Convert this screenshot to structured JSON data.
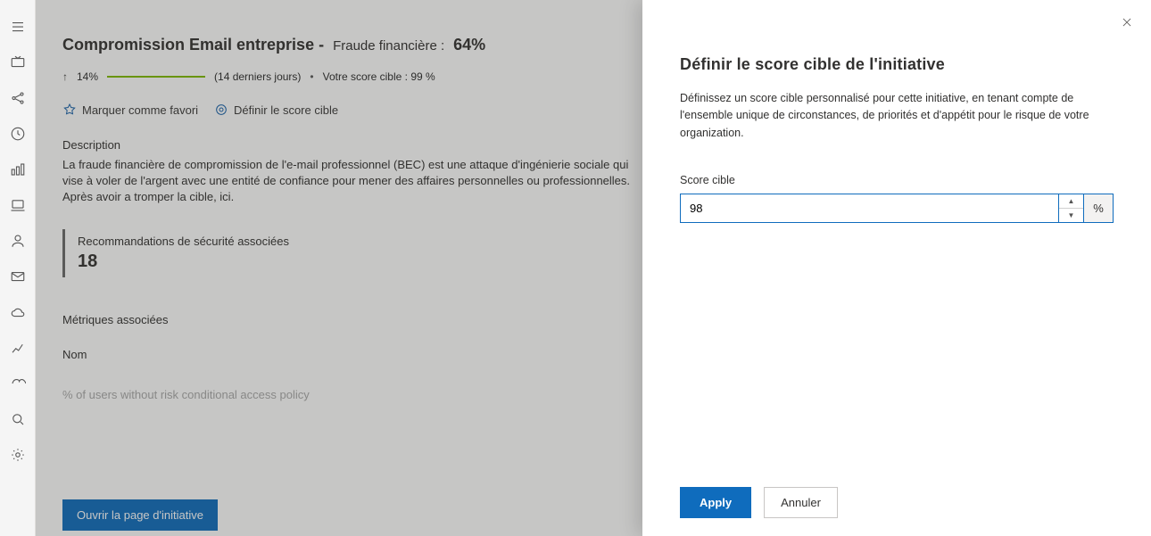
{
  "header": {
    "title_primary": "Compromission Email entreprise -",
    "title_secondary": "Fraude financière :",
    "score_percent": "64%"
  },
  "metrics": {
    "trend_value": "14%",
    "trend_period": "(14 derniers jours)",
    "target_score_text": "Votre score cible : 99 %"
  },
  "actions": {
    "favorite_label": "Marquer comme favori",
    "set_target_label": "Définir le score cible"
  },
  "description": {
    "label": "Description",
    "text": "La fraude financière de compromission de l'e-mail professionnel (BEC) est une attaque d'ingénierie sociale qui vise à voler de l'argent avec une entité de confiance pour mener des affaires personnelles ou professionnelles. Après avoir      a tromper la cible, ici."
  },
  "recommendations": {
    "label": "Recommandations de sécurité associées",
    "count": "18"
  },
  "associated_metrics": {
    "label": "Métriques associées",
    "column_name": "Nom",
    "row0": "% of users without risk conditional access policy"
  },
  "buttons": {
    "open_initiative": "Ouvrir la page d'initiative"
  },
  "panel": {
    "title": "Définir le score cible de l'initiative",
    "description": "Définissez un score cible personnalisé pour cette initiative, en tenant compte de l'ensemble unique de circonstances, de priorités et d'appétit pour le risque de votre organization.",
    "field_label": "Score cible",
    "field_value": "98",
    "field_suffix": "%",
    "apply_label": "Apply",
    "cancel_label": "Annuler"
  }
}
